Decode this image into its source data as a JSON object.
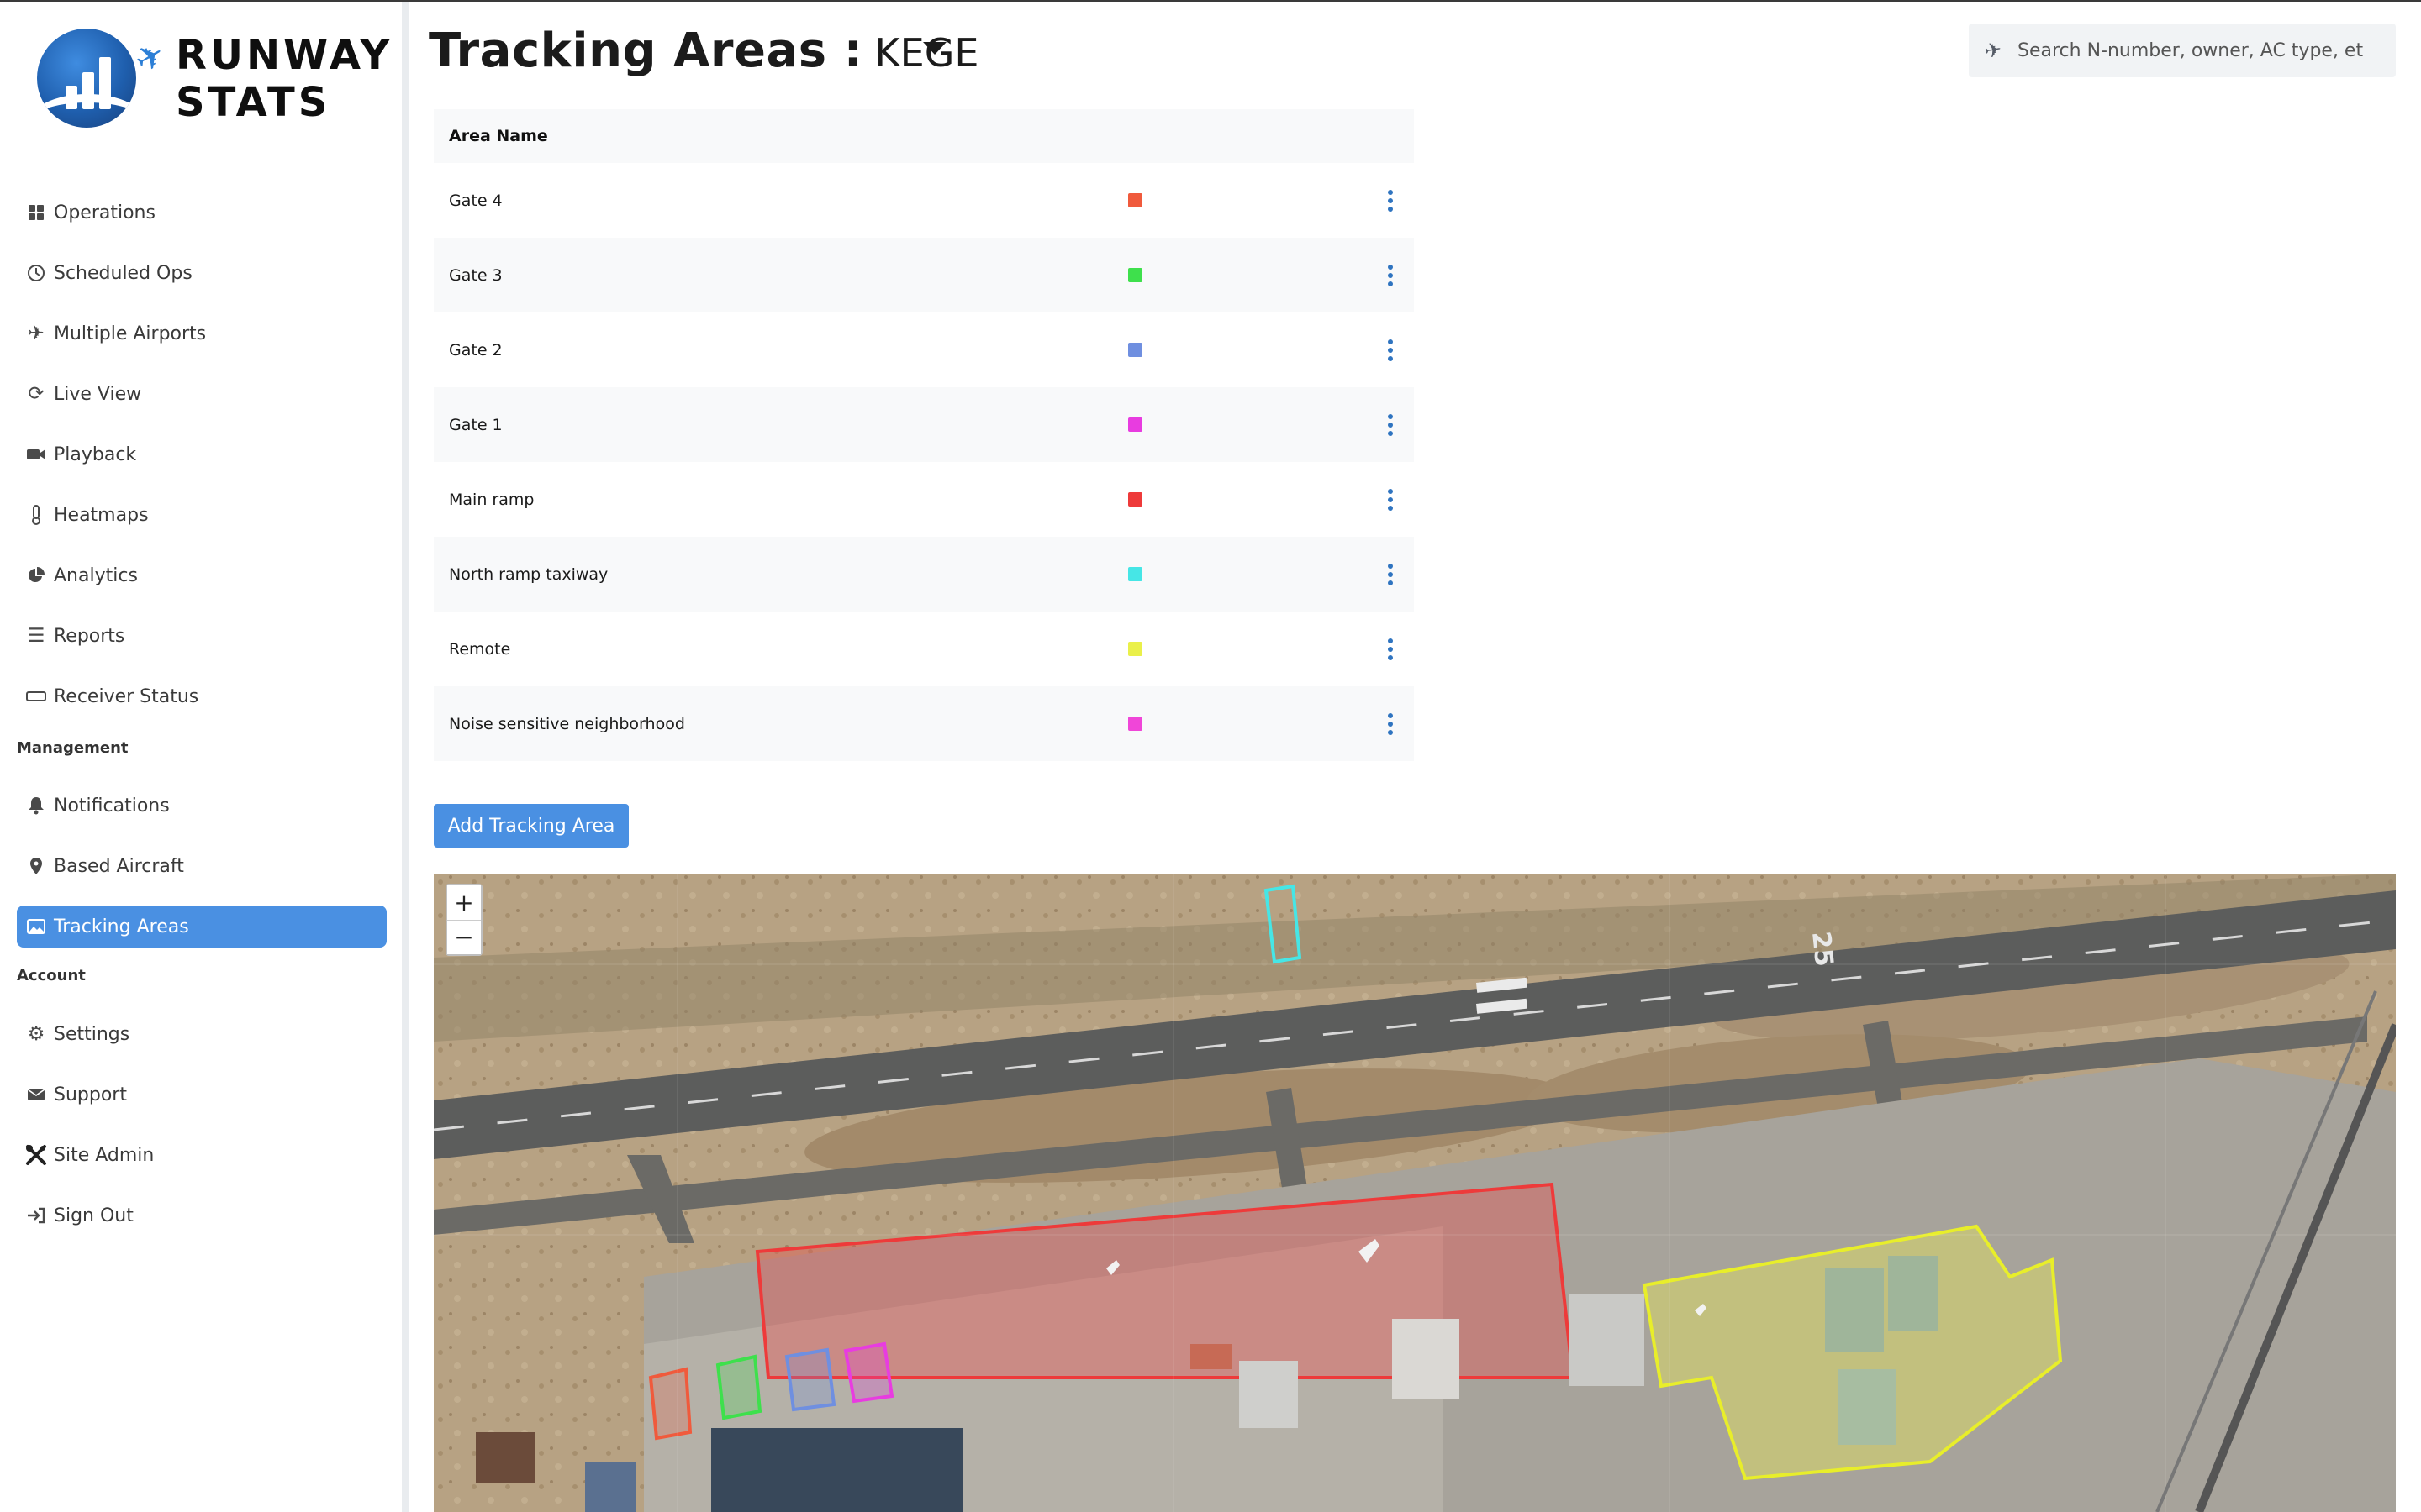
{
  "brand": {
    "line1": "RUNWAY",
    "line2": "STATS"
  },
  "sidebar": {
    "items": [
      {
        "label": "Operations",
        "icon": "grid-icon"
      },
      {
        "label": "Scheduled Ops",
        "icon": "clock-icon"
      },
      {
        "label": "Multiple Airports",
        "icon": "plane-icon"
      },
      {
        "label": "Live View",
        "icon": "refresh-icon"
      },
      {
        "label": "Playback",
        "icon": "video-icon"
      },
      {
        "label": "Heatmaps",
        "icon": "thermometer-icon"
      },
      {
        "label": "Analytics",
        "icon": "pie-chart-icon"
      },
      {
        "label": "Reports",
        "icon": "list-icon"
      },
      {
        "label": "Receiver Status",
        "icon": "receiver-icon"
      }
    ],
    "section_management": "Management",
    "management_items": [
      {
        "label": "Notifications",
        "icon": "bell-icon"
      },
      {
        "label": "Based Aircraft",
        "icon": "map-pin-icon"
      },
      {
        "label": "Tracking Areas",
        "icon": "image-icon",
        "active": true
      }
    ],
    "section_account": "Account",
    "account_items": [
      {
        "label": "Settings",
        "icon": "gear-icon"
      },
      {
        "label": "Support",
        "icon": "envelope-icon"
      },
      {
        "label": "Site Admin",
        "icon": "tools-icon"
      },
      {
        "label": "Sign Out",
        "icon": "sign-out-icon"
      }
    ]
  },
  "header": {
    "title": "Tracking Areas :",
    "airport": "KEGE",
    "search_placeholder": "Search N-number, owner, AC type, et"
  },
  "table": {
    "column_name": "Area Name",
    "rows": [
      {
        "name": "Gate 4",
        "color": "#f05a3c"
      },
      {
        "name": "Gate 3",
        "color": "#3ee04c"
      },
      {
        "name": "Gate 2",
        "color": "#6f8fe0"
      },
      {
        "name": "Gate 1",
        "color": "#e83ce0"
      },
      {
        "name": "Main ramp",
        "color": "#ee3a3a"
      },
      {
        "name": "North ramp taxiway",
        "color": "#46e6e6"
      },
      {
        "name": "Remote",
        "color": "#eaf04a"
      },
      {
        "name": "Noise sensitive neighborhood",
        "color": "#f046d8"
      }
    ]
  },
  "add_button": "Add Tracking Area",
  "map": {
    "zoom_in": "+",
    "zoom_out": "−",
    "runway_number": "25"
  }
}
